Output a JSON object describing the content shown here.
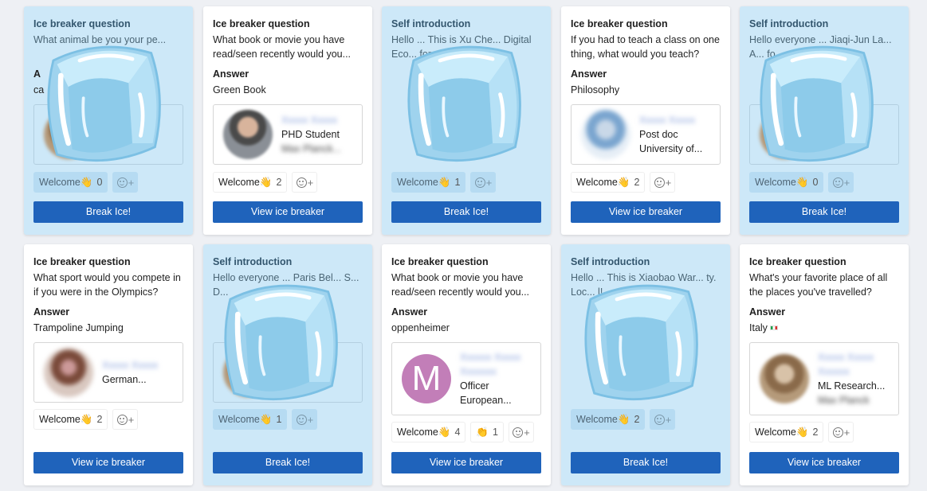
{
  "colors": {
    "button_blue": "#1f63bb",
    "ice_card_bg": "#cde8f8",
    "page_bg": "#eef0f4"
  },
  "icons": [
    "ice-cube-overlay",
    "add-reaction-icon",
    "waving-hand-emoji",
    "italy-flag"
  ],
  "cards": [
    {
      "label": "Ice breaker question",
      "text": "What animal be you your pe...",
      "answer_label": "A",
      "answer": "ca",
      "react_label": "Welcome👋",
      "react_count": "0",
      "button": "Break Ice!"
    },
    {
      "label": "Ice breaker question",
      "text": "What book or movie you have read/seen recently would you...",
      "answer_label": "Answer",
      "answer": "Green Book",
      "name": "Xxxxx Xxxxx",
      "role": "PHD Student",
      "org": "Max Planck...",
      "react_label": "Welcome👋",
      "react_count": "2",
      "button": "View ice breaker"
    },
    {
      "label": "Self introduction",
      "text": "Hello ... This is Xu Che... Digital Eco... for...",
      "react_label": "Welcome👋",
      "react_count": "1",
      "button": "Break Ice!"
    },
    {
      "label": "Ice breaker question",
      "text": "If you had to teach a class on one thing, what would you teach?",
      "answer_label": "Answer",
      "answer": "Philosophy",
      "name": "Xxxxx Xxxxx",
      "role": "Post doc",
      "org": "University of...",
      "react_label": "Welcome👋",
      "react_count": "2",
      "button": "View ice breaker"
    },
    {
      "label": "Self introduction",
      "text": "Hello everyone ... Jiaqi-Jun La... A... fo...",
      "react_label": "Welcome👋",
      "react_count": "0",
      "button": "Break Ice!"
    },
    {
      "label": "Ice breaker question",
      "text": "What sport would you compete in if you were in the Olympics?",
      "answer_label": "Answer",
      "answer": "Trampoline Jumping",
      "name": "Xxxxx Xxxxx",
      "role": "German...",
      "react_label": "Welcome👋",
      "react_count": "2",
      "button": "View ice breaker"
    },
    {
      "label": "Self introduction",
      "text": "Hello everyone ... Paris Bel... S... D...",
      "react_label": "Welcome👋",
      "react_count": "1",
      "button": "Break Ice!"
    },
    {
      "label": "Ice breaker question",
      "text": "What book or movie you have read/seen recently would you...",
      "answer_label": "Answer",
      "answer": "oppenheimer",
      "avatar_letter": "M",
      "name": "Xxxxxx Xxxxx",
      "role": "Officer",
      "org": "European...",
      "react_label": "Welcome👋",
      "react_count": "4",
      "react2_label": "👏",
      "react2_count": "1",
      "button": "View ice breaker"
    },
    {
      "label": "Self introduction",
      "text": "Hello ... This is Xiaobao War... ty. Loc... l!",
      "react_label": "Welcome👋",
      "react_count": "2",
      "button": "Break Ice!"
    },
    {
      "label": "Ice breaker question",
      "text": "What's your favorite place of all the places you've travelled?",
      "answer_label": "Answer",
      "answer": "Italy",
      "name": "Xxxxx Xxxxx",
      "role": "ML Research...",
      "org": "Max Planck",
      "react_label": "Welcome👋",
      "react_count": "2",
      "button": "View ice breaker"
    }
  ]
}
